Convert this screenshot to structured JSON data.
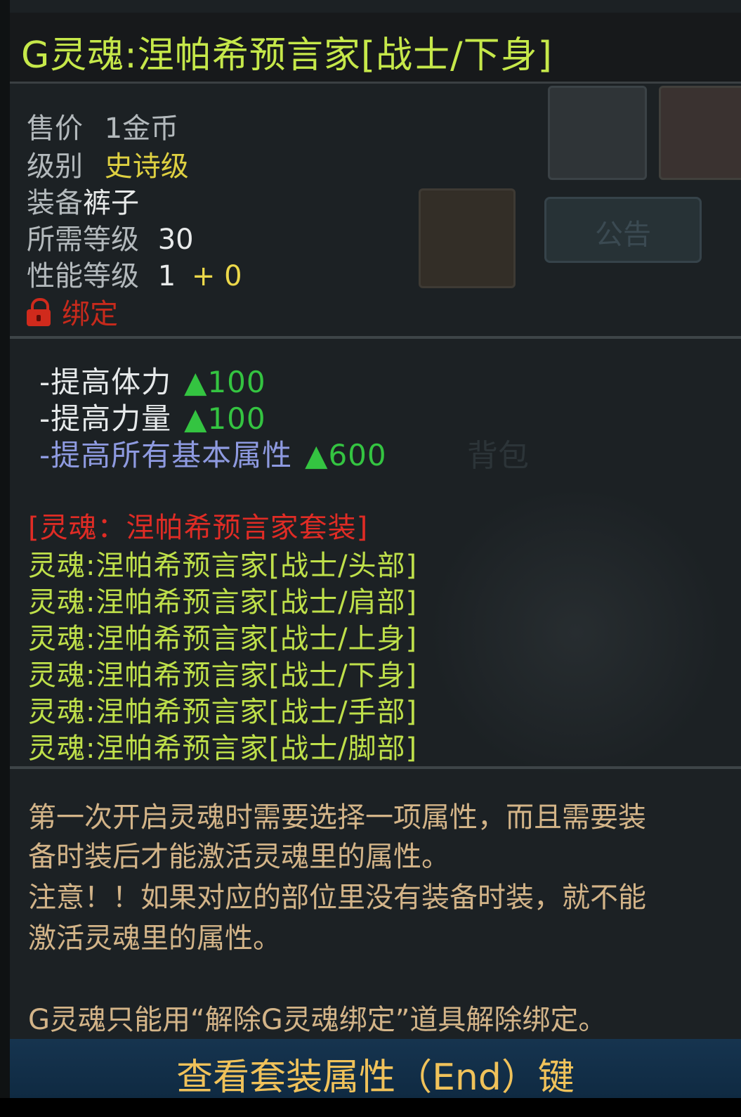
{
  "item": {
    "title": "G灵魂:涅帕希预言家[战士/下身]"
  },
  "info": {
    "price_label": "售价",
    "price_value": "1金币",
    "rarity_label": "级别",
    "rarity_value": "史诗级",
    "equip_label": "装备",
    "equip_value": "裤子",
    "req_level_label": "所需等级",
    "req_level_value": "30",
    "perf_label": "性能等级",
    "perf_base": "1",
    "perf_bonus": "+ 0",
    "bind_text": "绑定"
  },
  "attributes": [
    {
      "label": "-提高体力",
      "value": "▲100"
    },
    {
      "label": "-提高力量",
      "value": "▲100"
    },
    {
      "label": "-提高所有基本属性",
      "value": "▲600"
    }
  ],
  "set": {
    "title": "[灵魂：涅帕希预言家套装]",
    "items": [
      "灵魂:涅帕希预言家[战士/头部]",
      "灵魂:涅帕希预言家[战士/肩部]",
      "灵魂:涅帕希预言家[战士/上身]",
      "灵魂:涅帕希预言家[战士/下身]",
      "灵魂:涅帕希预言家[战士/手部]",
      "灵魂:涅帕希预言家[战士/脚部]"
    ]
  },
  "description": {
    "lines": [
      "第一次开启灵魂时需要选择一项属性，而且需要装",
      "备时装后才能激活灵魂里的属性。",
      "注意！！如果对应的部位里没有装备时装，就不能",
      "激活灵魂里的属性。",
      "G灵魂只能用“解除G灵魂绑定”道具解除绑定。"
    ]
  },
  "footer": {
    "label": "查看套装属性（End）键"
  },
  "background_ui": {
    "notice_button": "公告",
    "bag_label": "背包"
  },
  "colors": {
    "title": "#c6e84a",
    "epic": "#ded041",
    "bound": "#c62a1c",
    "attr_up": "#34c441",
    "set_title": "#e02c25",
    "set_item": "#bfe04a",
    "description": "#d3b488",
    "footer_text": "#f0c25a"
  },
  "icons": {
    "bind": "lock-icon",
    "increase": "up-triangle"
  }
}
